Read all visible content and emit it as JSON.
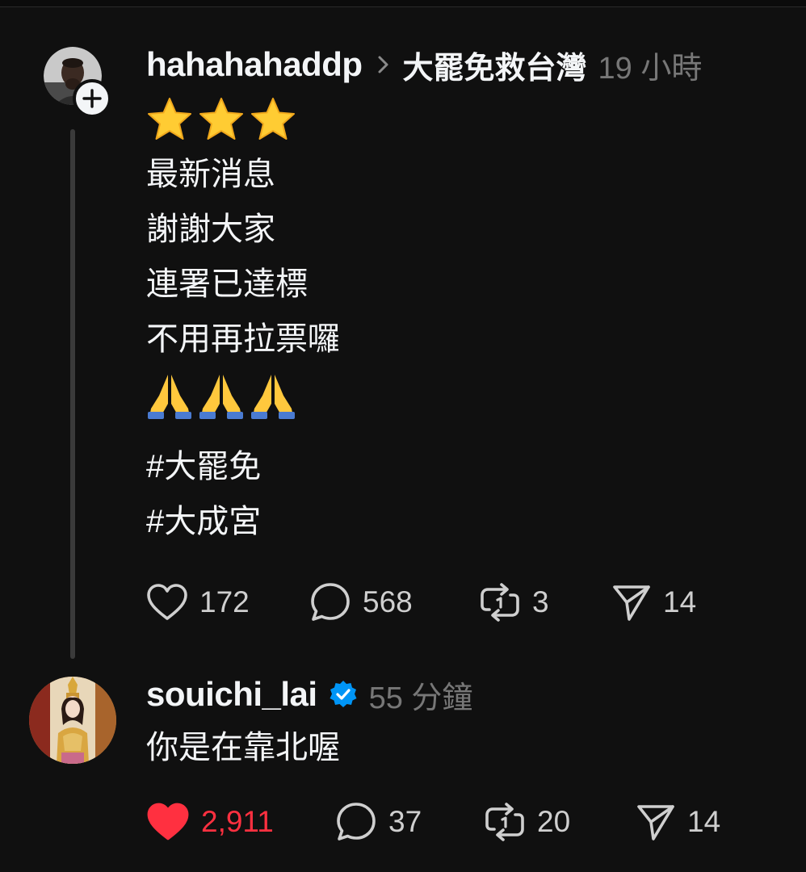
{
  "post1": {
    "username": "hahahahaddp",
    "community": "大罷免救台灣",
    "timestamp": "19 小時",
    "lines": [
      "最新消息",
      "謝謝大家",
      "連署已達標",
      "不用再拉票囉"
    ],
    "hashtags": [
      "#大罷免",
      "#大成宮"
    ],
    "top_emoji": "star-icon",
    "bottom_emoji": "folded-hands-icon",
    "actions": {
      "likes": "172",
      "comments": "568",
      "reposts": "3",
      "shares": "14"
    }
  },
  "post2": {
    "username": "souichi_lai",
    "timestamp": "55 分鐘",
    "text": "你是在靠北喔",
    "actions": {
      "likes": "2,911",
      "comments": "37",
      "reposts": "20",
      "shares": "14"
    }
  },
  "colors": {
    "background": "#101010",
    "liked": "#ff3040",
    "verified": "#0095f6",
    "muted": "#777777"
  }
}
